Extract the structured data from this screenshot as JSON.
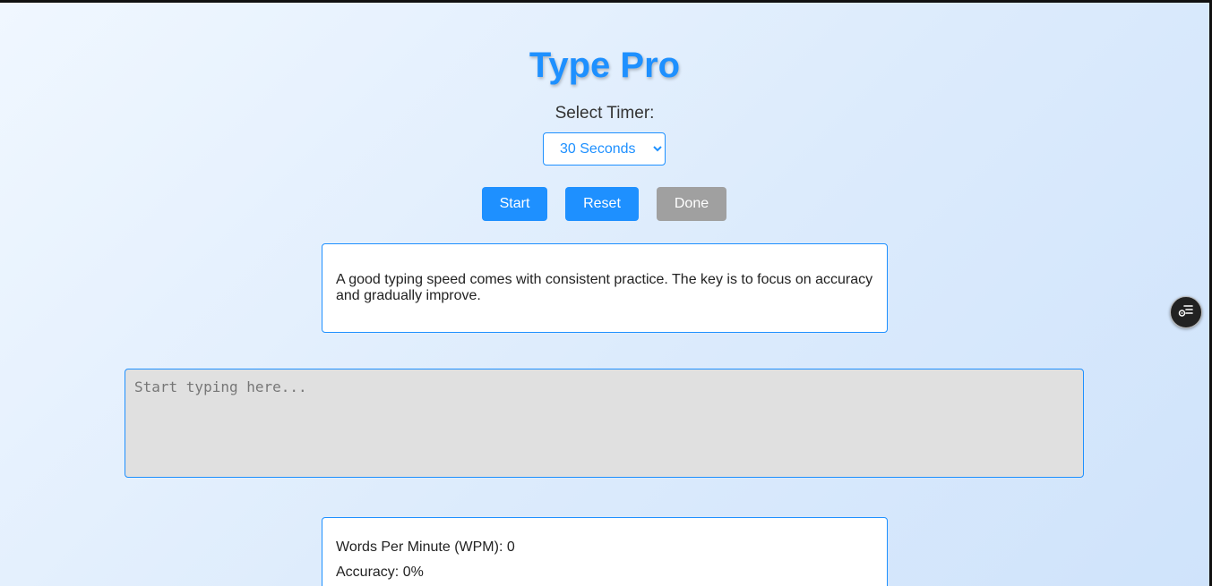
{
  "app": {
    "title": "Type Pro"
  },
  "timer": {
    "label": "Select Timer:",
    "selected": "30 Seconds"
  },
  "controls": {
    "start_label": "Start",
    "reset_label": "Reset",
    "done_label": "Done"
  },
  "passage": {
    "text": "A good typing speed comes with consistent practice. The key is to focus on accuracy and gradually improve."
  },
  "typing": {
    "placeholder": "Start typing here...",
    "value": ""
  },
  "results": {
    "wpm_label": "Words Per Minute (WPM): 0",
    "accuracy_label": "Accuracy: 0%"
  },
  "floating": {
    "icon": "list-settings-icon"
  },
  "colors": {
    "accent": "#1e90ff",
    "disabled": "#a0a0a0",
    "input_bg": "#e0e0e0"
  }
}
